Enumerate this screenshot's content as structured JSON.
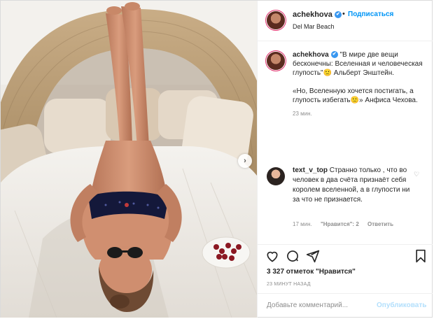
{
  "post": {
    "author": "achekhova",
    "location": "Del Mar Beach",
    "follow_label": "Подписаться",
    "dot": "•",
    "caption_lines": [
      "\"В мире две вещи бесконечны: Вселенная и человеческая глупость\"🙁 Альберт Энштейн."
    ],
    "caption_quote": "«Но, Вселенную хочется постигать, а глупость избегать🙁» Анфиса Чехова.",
    "caption_time": "23 мин."
  },
  "comment": {
    "author": "text_v_top",
    "text": "Странно только , что во человек в два счёта признаёт себя королем вселенной, а в глупости ни за что не признается.",
    "time": "17 мин.",
    "likes": "\"Нравится\": 2",
    "reply": "Ответить"
  },
  "actions": {
    "likes_count": "3 327 отметок \"Нравится\"",
    "posted_time": "23 МИНУТ НАЗАД"
  },
  "composer": {
    "placeholder": "Добавьте комментарий...",
    "publish_label": "Опубликовать"
  },
  "icons": {
    "verified": "✔",
    "next": "›",
    "heart_small": "♡"
  },
  "colors": {
    "accent": "#0095f6",
    "publish_disabled": "#b2dffc",
    "verified": "#3897f0"
  }
}
